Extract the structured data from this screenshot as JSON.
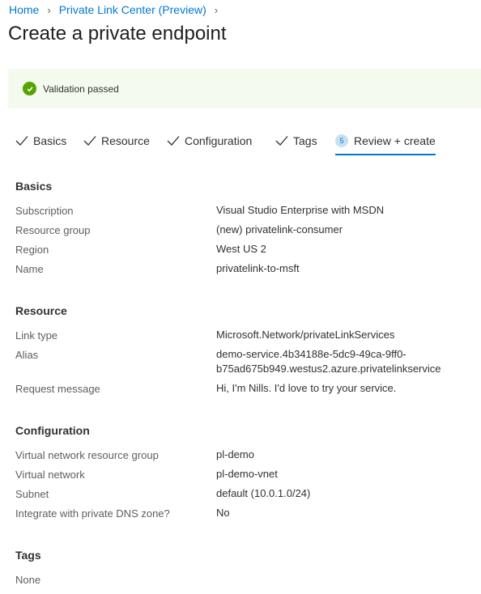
{
  "breadcrumb": {
    "home": "Home",
    "parent": "Private Link Center (Preview)"
  },
  "page_title": "Create a private endpoint",
  "validation": {
    "message": "Validation passed",
    "status_color": "#57a300"
  },
  "tabs": [
    {
      "label": "Basics",
      "state": "completed"
    },
    {
      "label": "Resource",
      "state": "completed"
    },
    {
      "label": "Configuration",
      "state": "completed"
    },
    {
      "label": "Tags",
      "state": "completed"
    },
    {
      "label": "Review + create",
      "state": "active",
      "step": "5"
    }
  ],
  "sections": {
    "basics": {
      "title": "Basics",
      "rows": [
        {
          "label": "Subscription",
          "value": "Visual Studio Enterprise with MSDN"
        },
        {
          "label": "Resource group",
          "value": "(new) privatelink-consumer"
        },
        {
          "label": "Region",
          "value": "West US 2"
        },
        {
          "label": "Name",
          "value": "privatelink-to-msft"
        }
      ]
    },
    "resource": {
      "title": "Resource",
      "rows": [
        {
          "label": "Link type",
          "value": "Microsoft.Network/privateLinkServices"
        },
        {
          "label": "Alias",
          "value": "demo-service.4b34188e-5dc9-49ca-9ff0-",
          "value_line2": "b75ad675b949.westus2.azure.privatelinkservice"
        },
        {
          "label": "Request message",
          "value": "Hi, I'm Nills. I'd love to try your service."
        }
      ]
    },
    "configuration": {
      "title": "Configuration",
      "rows": [
        {
          "label": "Virtual network resource group",
          "value": "pl-demo"
        },
        {
          "label": "Virtual network",
          "value": "pl-demo-vnet"
        },
        {
          "label": "Subnet",
          "value": "default (10.0.1.0/24)"
        },
        {
          "label": "Integrate with private DNS zone?",
          "value": "No"
        }
      ]
    },
    "tags": {
      "title": "Tags",
      "empty_text": "None"
    }
  }
}
